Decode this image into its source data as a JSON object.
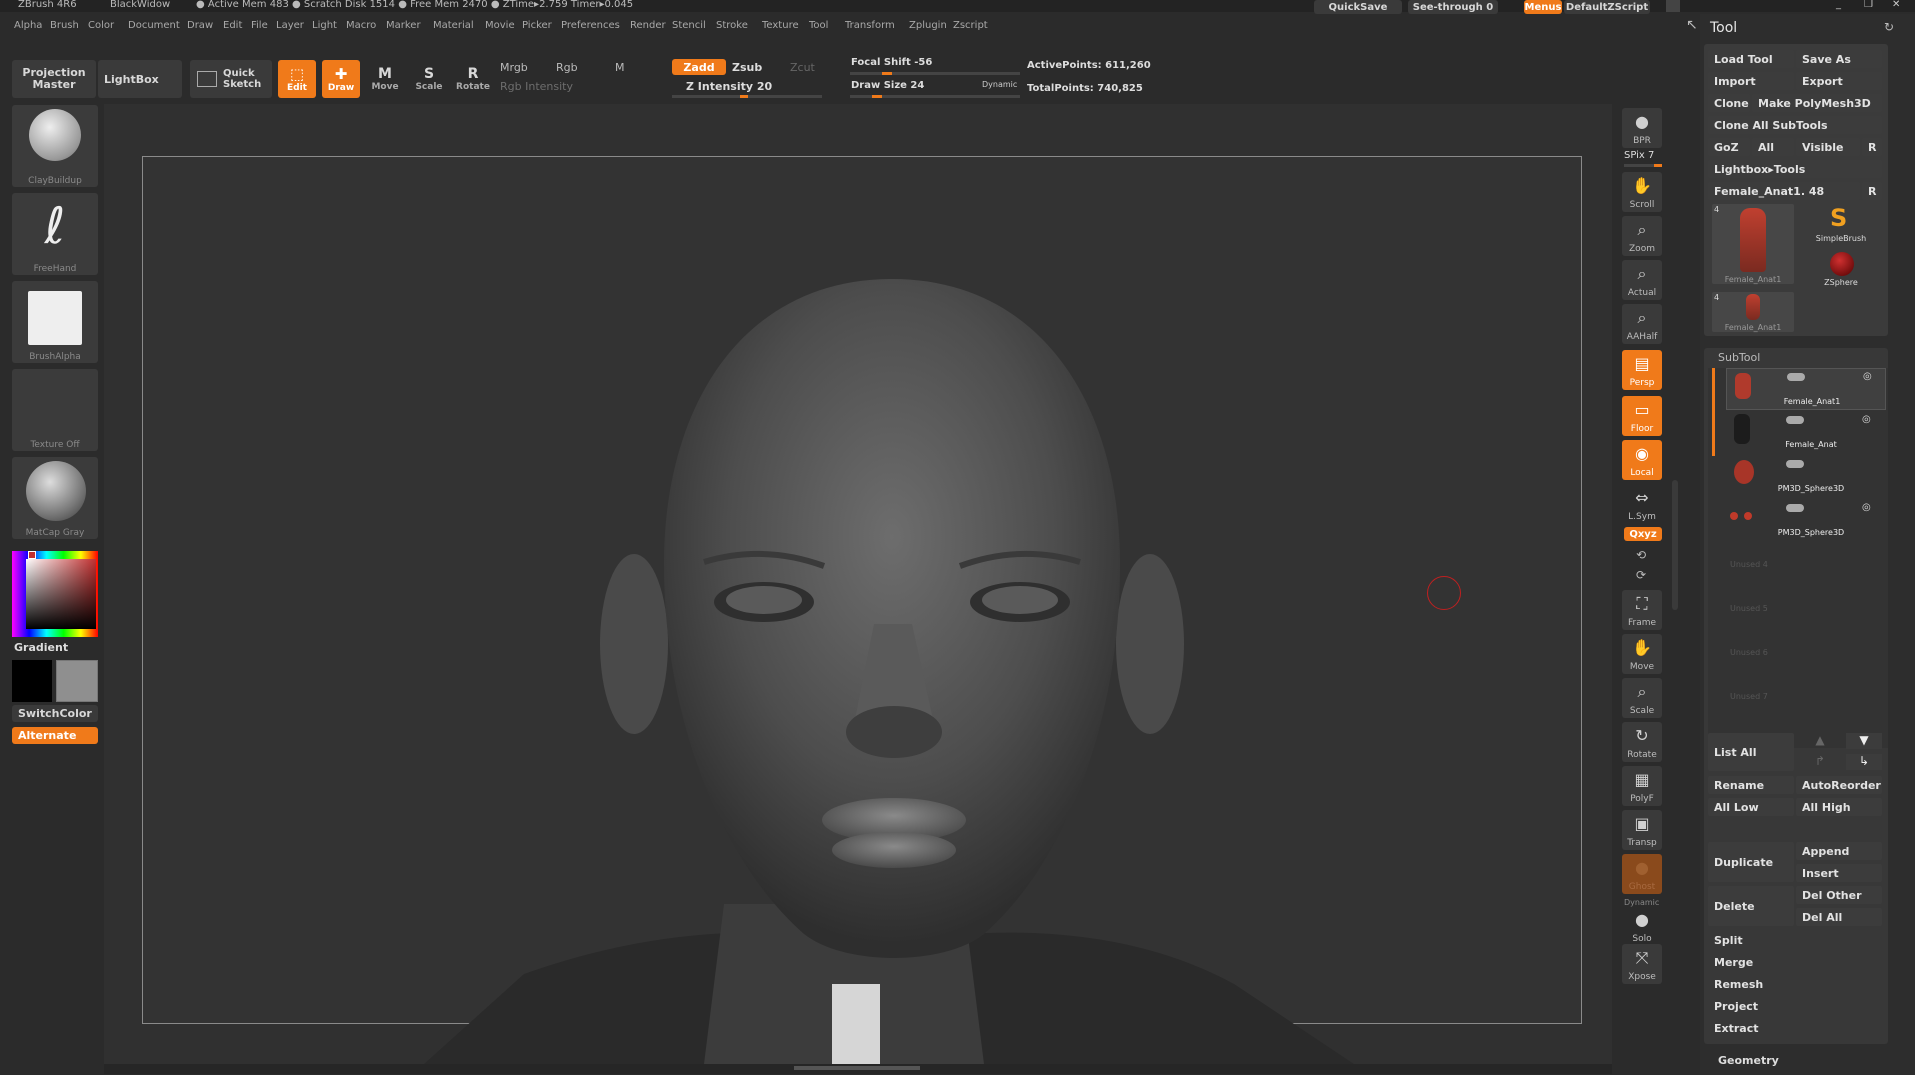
{
  "titlebar": {
    "app": "ZBrush 4R6",
    "window": "BlackWidow",
    "stats": "● Active Mem 483  ● Scratch Disk 1514  ● Free Mem 2470  ● ZTime▸2.759  Timer▸0.045",
    "quicksave": "QuickSave",
    "seethrough": "See-through   0",
    "menus": "Menus",
    "script": "DefaultZScript"
  },
  "menubar": [
    "Alpha",
    "Brush",
    "Color",
    "Document",
    "Draw",
    "Edit",
    "File",
    "Layer",
    "Light",
    "Macro",
    "Marker",
    "Material",
    "Movie",
    "Picker",
    "Preferences",
    "Render",
    "Stencil",
    "Stroke",
    "Texture",
    "Tool",
    "Transform",
    "Zplugin",
    "Zscript"
  ],
  "toolbar": {
    "projection_master": "Projection Master",
    "lightbox": "LightBox",
    "quick_sketch": "Quick Sketch",
    "edit": "Edit",
    "draw": "Draw",
    "move": "Move",
    "scale": "Scale",
    "rotate": "Rotate",
    "mrgb": "Mrgb",
    "rgb": "Rgb",
    "m": "M",
    "rgb_intensity": "Rgb Intensity",
    "zadd": "Zadd",
    "zsub": "Zsub",
    "zcut": "Zcut",
    "z_intensity": "Z Intensity 20",
    "focal_shift": "Focal Shift -56",
    "draw_size": "Draw Size 24",
    "dynamic": "Dynamic",
    "active_points": "ActivePoints: 611,260",
    "total_points": "TotalPoints: 740,825"
  },
  "left_tray": {
    "brush": "ClayBuildup",
    "stroke": "FreeHand",
    "alpha": "BrushAlpha",
    "texture": "Texture Off",
    "material": "MatCap Gray",
    "gradient": "Gradient",
    "switch_color": "SwitchColor",
    "alternate": "Alternate"
  },
  "right_shelf": {
    "bpr": "BPR",
    "spix": "SPix 7",
    "scroll": "Scroll",
    "zoom": "Zoom",
    "actual": "Actual",
    "aahalf": "AAHalf",
    "persp": "Persp",
    "floor": "Floor",
    "local": "Local",
    "lsym": "L.Sym",
    "xyz": "Qxyz",
    "frame": "Frame",
    "move": "Move",
    "scale": "Scale",
    "rotate": "Rotate",
    "polyf": "PolyF",
    "transp": "Transp",
    "ghost": "Ghost",
    "dynamic": "Dynamic",
    "solo": "Solo",
    "xpose": "Xpose"
  },
  "tool_panel": {
    "title": "Tool",
    "load_tool": "Load Tool",
    "save_as": "Save As",
    "import": "Import",
    "export": "Export",
    "clone": "Clone",
    "make_polymesh": "Make PolyMesh3D",
    "clone_all": "Clone All SubTools",
    "goz": "GoZ",
    "all": "All",
    "visible": "Visible",
    "r": "R",
    "lightbox_tools": "Lightbox▸Tools",
    "current_tool": "Female_Anat1. 48",
    "thumb1_label": "Female_Anat1",
    "thumb1_count": "4",
    "simplebrush": "SimpleBrush",
    "zsphere": "ZSphere",
    "thumb2_label": "Female_Anat1",
    "thumb2_count": "4",
    "subtool_header": "SubTool",
    "subtools": [
      "Female_Anat1",
      "Female_Anat",
      "PM3D_Sphere3D",
      "PM3D_Sphere3D"
    ],
    "unused": [
      "Unused 4",
      "Unused 5",
      "Unused 6",
      "Unused 7"
    ],
    "list_all": "List All",
    "rename": "Rename",
    "autoreorder": "AutoReorder",
    "all_low": "All Low",
    "all_high": "All High",
    "duplicate": "Duplicate",
    "append": "Append",
    "insert": "Insert",
    "delete": "Delete",
    "del_other": "Del Other",
    "del_all": "Del All",
    "split": "Split",
    "merge": "Merge",
    "remesh": "Remesh",
    "project": "Project",
    "extract": "Extract",
    "geometry": "Geometry"
  },
  "colors": {
    "accent": "#f07a1a",
    "panel": "#3a3a3a",
    "bg": "#2b2b2b"
  }
}
